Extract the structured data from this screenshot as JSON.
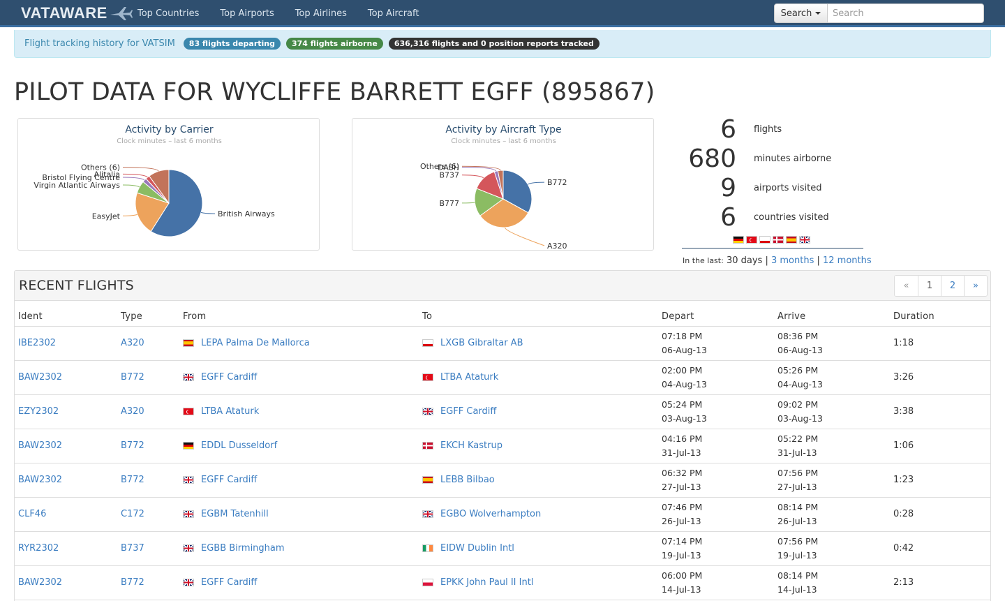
{
  "nav": {
    "brand": "VATAWARE",
    "links": [
      "Top Countries",
      "Top Airports",
      "Top Airlines",
      "Top Aircraft"
    ],
    "search_button": "Search",
    "search_placeholder": "Search"
  },
  "infobar": {
    "text": "Flight tracking history for VATSIM",
    "departing": "83 flights departing",
    "airborne": "374 flights airborne",
    "tracked": "636,316 flights and 0 position reports tracked"
  },
  "page_title": "PILOT DATA FOR WYCLIFFE BARRETT EGFF (895867)",
  "chart_data": [
    {
      "type": "pie",
      "title": "Activity by Carrier",
      "subtitle": "Clock minutes – last 6 months",
      "slices": [
        {
          "label": "British Airways",
          "value": 59,
          "color": "#4572a7"
        },
        {
          "label": "EasyJet",
          "value": 21,
          "color": "#eda35c"
        },
        {
          "label": "Virgin Atlantic Airways",
          "value": 6,
          "color": "#8bbc63"
        },
        {
          "label": "Bristol Flying Centre",
          "value": 2,
          "color": "#9a78b9"
        },
        {
          "label": "Alitalia",
          "value": 2,
          "color": "#d4565b"
        },
        {
          "label": "Others (6)",
          "value": 10,
          "color": "#c2735a"
        }
      ]
    },
    {
      "type": "pie",
      "title": "Activity by Aircraft Type",
      "subtitle": "Clock minutes – last 6 months",
      "slices": [
        {
          "label": "B772",
          "value": 33,
          "color": "#4572a7"
        },
        {
          "label": "A320",
          "value": 32,
          "color": "#eda35c"
        },
        {
          "label": "B777",
          "value": 16,
          "color": "#8bbc63"
        },
        {
          "label": "B737",
          "value": 14,
          "color": "#d4565b"
        },
        {
          "label": "DASH",
          "value": 2,
          "color": "#9a78b9"
        },
        {
          "label": "Others (6)",
          "value": 3,
          "color": "#c2735a"
        }
      ]
    }
  ],
  "stats": {
    "flights_num": "6",
    "flights_lbl": "flights",
    "minutes_num": "680",
    "minutes_lbl": "minutes airborne",
    "airports_num": "9",
    "airports_lbl": "airports visited",
    "countries_num": "6",
    "countries_lbl": "countries visited",
    "flags": [
      "de",
      "tr",
      "gi",
      "dk",
      "es",
      "gb"
    ],
    "in_last_label": "In the last:",
    "period_current": "30 days",
    "period_3": "3 months",
    "period_12": "12 months"
  },
  "recent": {
    "title": "RECENT FLIGHTS",
    "pager": [
      "«",
      "1",
      "2",
      "»"
    ],
    "columns": [
      "Ident",
      "Type",
      "From",
      "To",
      "Depart",
      "Arrive",
      "Duration"
    ],
    "rows": [
      {
        "ident": "IBE2302",
        "type": "A320",
        "from_flag": "es",
        "from": "LEPA Palma De Mallorca",
        "to_flag": "gi",
        "to": "LXGB Gibraltar AB",
        "dep_time": "07:18 PM",
        "dep_date": "06-Aug-13",
        "arr_time": "08:36 PM",
        "arr_date": "06-Aug-13",
        "duration": "1:18"
      },
      {
        "ident": "BAW2302",
        "type": "B772",
        "from_flag": "gb",
        "from": "EGFF Cardiff",
        "to_flag": "tr",
        "to": "LTBA Ataturk",
        "dep_time": "02:00 PM",
        "dep_date": "04-Aug-13",
        "arr_time": "05:26 PM",
        "arr_date": "04-Aug-13",
        "duration": "3:26"
      },
      {
        "ident": "EZY2302",
        "type": "A320",
        "from_flag": "tr",
        "from": "LTBA Ataturk",
        "to_flag": "gb",
        "to": "EGFF Cardiff",
        "dep_time": "05:24 PM",
        "dep_date": "03-Aug-13",
        "arr_time": "09:02 PM",
        "arr_date": "03-Aug-13",
        "duration": "3:38"
      },
      {
        "ident": "BAW2302",
        "type": "B772",
        "from_flag": "de",
        "from": "EDDL Dusseldorf",
        "to_flag": "dk",
        "to": "EKCH Kastrup",
        "dep_time": "04:16 PM",
        "dep_date": "31-Jul-13",
        "arr_time": "05:22 PM",
        "arr_date": "31-Jul-13",
        "duration": "1:06"
      },
      {
        "ident": "BAW2302",
        "type": "B772",
        "from_flag": "gb",
        "from": "EGFF Cardiff",
        "to_flag": "es",
        "to": "LEBB Bilbao",
        "dep_time": "06:32 PM",
        "dep_date": "27-Jul-13",
        "arr_time": "07:56 PM",
        "arr_date": "27-Jul-13",
        "duration": "1:23"
      },
      {
        "ident": "CLF46",
        "type": "C172",
        "from_flag": "gb",
        "from": "EGBM Tatenhill",
        "to_flag": "gb",
        "to": "EGBO Wolverhampton",
        "dep_time": "07:46 PM",
        "dep_date": "26-Jul-13",
        "arr_time": "08:14 PM",
        "arr_date": "26-Jul-13",
        "duration": "0:28"
      },
      {
        "ident": "RYR2302",
        "type": "B737",
        "from_flag": "gb",
        "from": "EGBB Birmingham",
        "to_flag": "ie",
        "to": "EIDW Dublin Intl",
        "dep_time": "07:14 PM",
        "dep_date": "19-Jul-13",
        "arr_time": "07:56 PM",
        "arr_date": "19-Jul-13",
        "duration": "0:42"
      },
      {
        "ident": "BAW2302",
        "type": "B772",
        "from_flag": "gb",
        "from": "EGFF Cardiff",
        "to_flag": "pl",
        "to": "EPKK John Paul II Intl",
        "dep_time": "06:00 PM",
        "dep_date": "14-Jul-13",
        "arr_time": "08:14 PM",
        "arr_date": "14-Jul-13",
        "duration": "2:13"
      }
    ]
  }
}
